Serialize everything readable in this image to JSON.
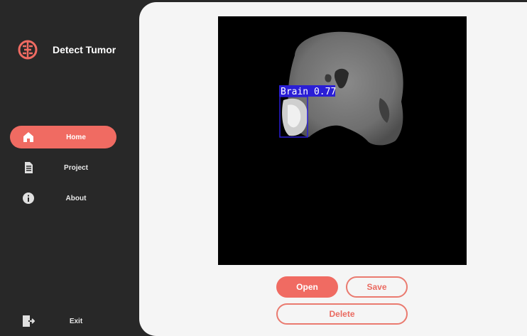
{
  "app": {
    "title": "Detect Tumor"
  },
  "nav": {
    "items": [
      {
        "label": "Home",
        "icon": "home-icon",
        "active": true
      },
      {
        "label": "Project",
        "icon": "document-icon",
        "active": false
      },
      {
        "label": "About",
        "icon": "info-icon",
        "active": false
      }
    ],
    "exit": {
      "label": "Exit",
      "icon": "logout-icon"
    }
  },
  "detection": {
    "label": "Brain 0.77"
  },
  "buttons": {
    "open": "Open",
    "save": "Save",
    "delete": "Delete"
  },
  "colors": {
    "accent": "#f06b62",
    "sidebar": "#282828",
    "panel": "#f5f5f5",
    "box": "#2a1ed6"
  }
}
